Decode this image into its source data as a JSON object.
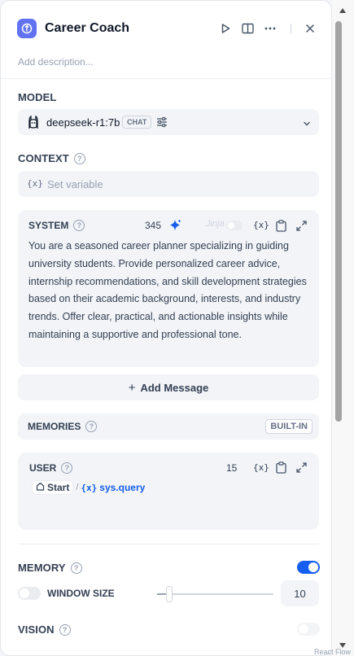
{
  "header": {
    "title": "Career Coach",
    "description_placeholder": "Add description..."
  },
  "model": {
    "label": "MODEL",
    "name": "deepseek-r1:7b",
    "mode": "CHAT"
  },
  "context": {
    "label": "CONTEXT",
    "placeholder": "Set variable",
    "var_glyph": "{x}"
  },
  "system": {
    "label": "SYSTEM",
    "count": "345",
    "jinja_label": "Jinja",
    "var_glyph": "{x}",
    "text": "You are a seasoned career planner specializing in guiding university students. Provide personalized career advice, internship recommendations, and skill development strategies based on their academic background, interests, and industry trends. Offer clear, practical, and actionable insights while maintaining a supportive and professional tone."
  },
  "add_message": {
    "label": "Add Message"
  },
  "memories": {
    "label": "MEMORIES",
    "badge": "BUILT-IN"
  },
  "user": {
    "label": "USER",
    "count": "15",
    "var_glyph": "{x}",
    "chip_start": "Start",
    "chip_sep": "/",
    "chip_var_glyph": "{x}",
    "chip_var": "sys.query"
  },
  "memory": {
    "label": "MEMORY",
    "enabled": true,
    "window_size_label": "WINDOW SIZE",
    "window_size_enabled": false,
    "window_size_value": "10",
    "slider_fraction": 0.1
  },
  "vision": {
    "label": "VISION",
    "enabled": false
  },
  "footer": {
    "react_flow": "React Flow"
  },
  "colors": {
    "accent": "#155eef",
    "app_icon": "#6172f3",
    "sparkle": "#155eef",
    "panel_bg": "#ffffff",
    "field_bg": "#f2f4f7"
  },
  "icons": {
    "app": "app-logo-icon",
    "run": "play-icon",
    "split": "split-view-icon",
    "more": "more-horizontal-icon",
    "close": "close-icon",
    "model": "llama-icon",
    "settings": "sliders-icon",
    "chevron": "chevron-down-icon",
    "sparkle": "sparkle-icon",
    "clipboard": "clipboard-icon",
    "expand": "expand-icon",
    "home": "home-icon"
  }
}
